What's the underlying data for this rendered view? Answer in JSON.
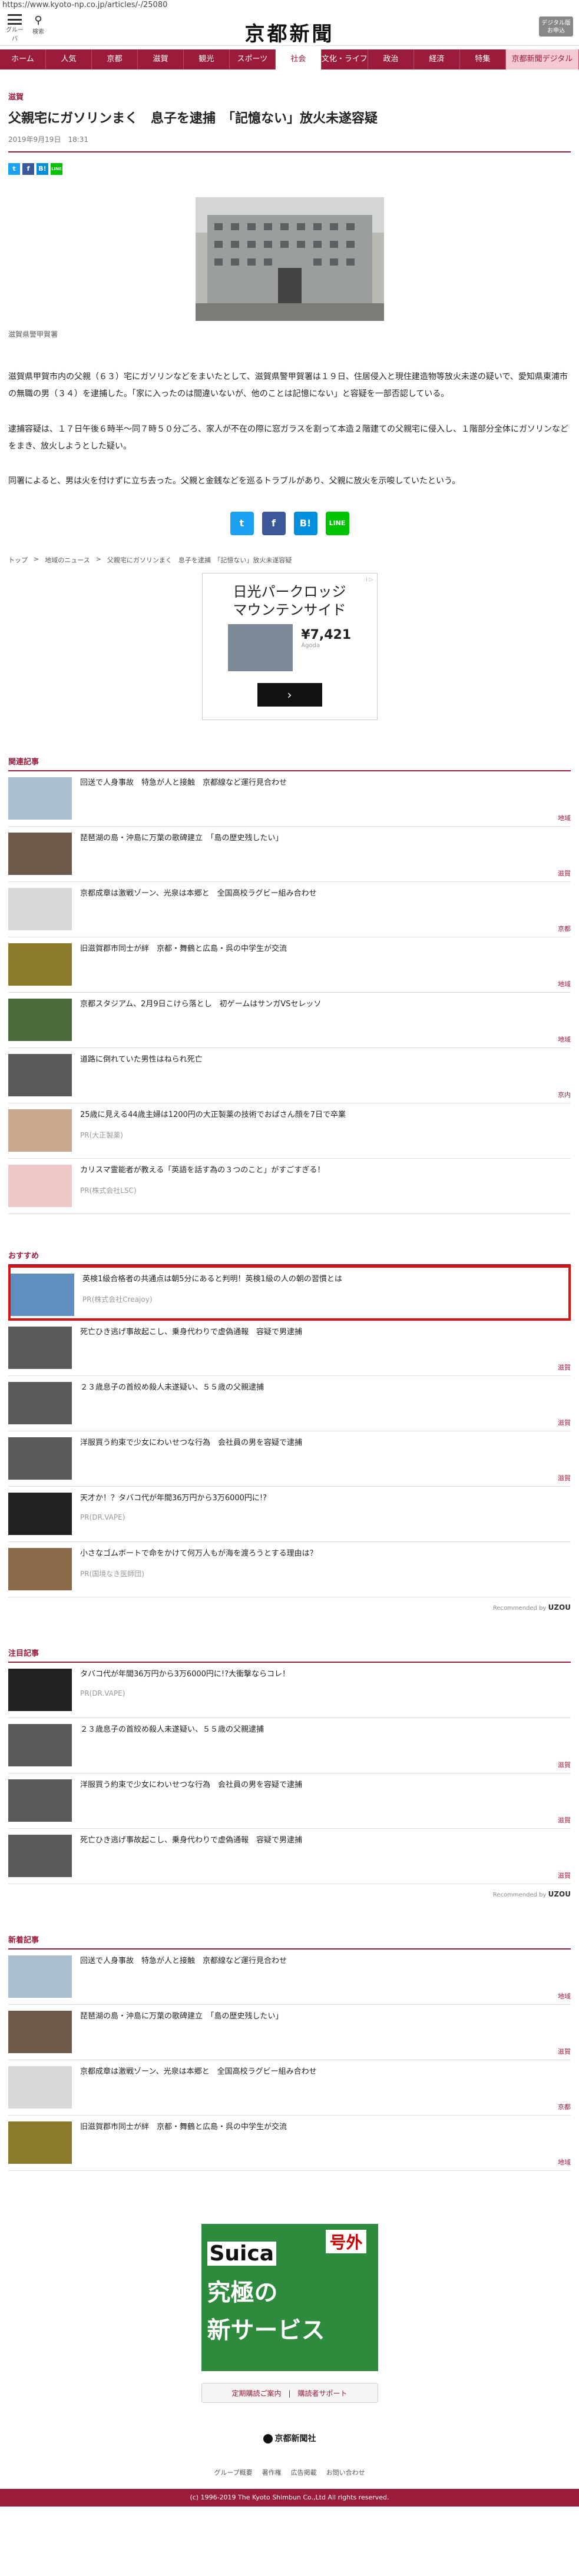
{
  "browser": {
    "url": "https://www.kyoto-np.co.jp/articles/-/25080"
  },
  "header": {
    "menu_label": "グルーバ",
    "search_label": "検索",
    "logo": "京都新聞",
    "digital_label": "デジタル版 お申込"
  },
  "nav": [
    "ホーム",
    "人気",
    "京都",
    "滋賀",
    "観光",
    "スポーツ",
    "社会",
    "文化・ライフ",
    "政治",
    "経済",
    "特集",
    "京都新聞デジタル"
  ],
  "article": {
    "section": "滋賀",
    "title": "父親宅にガソリンまく　息子を逮捕　「記憶ない」放火未遂容疑",
    "date": "2019年9月19日　18:31",
    "caption": "滋賀県警甲賀署",
    "paragraphs": [
      "滋賀県甲賀市内の父親（６３）宅にガソリンなどをまいたとして、滋賀県警甲賀署は１９日、住居侵入と現住建造物等放火未遂の疑いで、愛知県東浦市の無職の男（３４）を逮捕した。「家に入ったのは間違いないが、他のことは記憶にない」と容疑を一部否認している。",
      "逮捕容疑は、１７日午後６時半～同７時５０分ごろ、家人が不在の際に窓ガラスを割って本造２階建ての父親宅に侵入し、１階部分全体にガソリンなどをまき、放火しようとした疑い。",
      "同署によると、男は火を付けずに立ち去った。父親と金銭などを巡るトラブルがあり、父親に放火を示唆していたという。"
    ],
    "share": [
      "t",
      "f",
      "B!",
      "LINE"
    ]
  },
  "breadcrumb": [
    "トップ",
    ">",
    "地域のニュース",
    ">",
    "父親宅にガソリンまく　息子を逮捕　「記憶ない」放火未遂容疑"
  ],
  "ad": {
    "title_line1": "日光パークロッジ",
    "title_line2": "マウンテンサイド",
    "price": "¥7,421",
    "source": "Agoda",
    "arrow": "›",
    "tag": "i ▷"
  },
  "related": {
    "title": "関連記事",
    "items": [
      {
        "text": "回送で人身事故　特急が人と接触　京都線など運行見合わせ",
        "cat": "地域"
      },
      {
        "text": "琵琶湖の島・沖島に万葉の歌碑建立　「島の歴史残したい」",
        "cat": "滋賀"
      },
      {
        "text": "京都成章は激戦ゾーン、光泉は本郷と　全国高校ラグビー組み合わせ",
        "cat": "京都"
      },
      {
        "text": "旧滋賀郡市同士が絆　京都・舞鶴と広島・呉の中学生が交流",
        "cat": "地域"
      },
      {
        "text": "京都スタジアム、2月9日こけら落とし　初ゲームはサンガVSセレッソ",
        "cat": "地域"
      },
      {
        "text": "道路に倒れていた男性はねられ死亡",
        "cat": "京内"
      },
      {
        "text": "25歳に見える44歳主婦は1200円の大正製薬の技術でおばさん顔を7日で卒業",
        "sponsor": "PR(大正製薬)"
      },
      {
        "text": "カリスマ霊能者が教える「英語を話す為の３つのこと」がすごすぎる！",
        "sponsor": "PR(株式会社LSC)"
      }
    ]
  },
  "recommend": {
    "title": "おすすめ",
    "items": [
      {
        "text": "英検1級合格者の共通点は朝5分にあると判明！英検1級の人の朝の習慣とは",
        "sponsor": "PR(株式会社Creajoy)",
        "highlight": true
      },
      {
        "text": "死亡ひき逃げ事故起こし、乗身代わりで虚偽通報　容疑で男逮捕",
        "cat": "滋賀"
      },
      {
        "text": "２３歳息子の首絞め殺人未遂疑い、５５歳の父親逮捕",
        "cat": "滋賀"
      },
      {
        "text": "洋服買う約束で少女にわいせつな行為　会社員の男を容疑で逮捕",
        "cat": "滋賀"
      },
      {
        "text": "天才か！？タバコ代が年間36万円から3万6000円に!?",
        "sponsor": "PR(DR.VAPE)"
      },
      {
        "text": "小さなゴムボートで命をかけて何万人もが海を渡ろうとする理由は？",
        "sponsor": "PR(国境なき医師団)"
      }
    ],
    "credit_prefix": "Recommended by",
    "credit_brand": "UZOU"
  },
  "attention": {
    "title": "注目記事",
    "items": [
      {
        "text": "タバコ代が年間36万円から3万6000円に!?大衝撃ならコレ！",
        "sponsor": "PR(DR.VAPE)"
      },
      {
        "text": "２３歳息子の首絞め殺人未遂疑い、５５歳の父親逮捕",
        "cat": "滋賀"
      },
      {
        "text": "洋服買う約束で少女にわいせつな行為　会社員の男を容疑で逮捕",
        "cat": "滋賀"
      },
      {
        "text": "死亡ひき逃げ事故起こし、乗身代わりで虚偽通報　容疑で男逮捕",
        "cat": "滋賀"
      }
    ],
    "credit_prefix": "Recommended by",
    "credit_brand": "UZOU"
  },
  "latest": {
    "title": "新着記事",
    "items": [
      {
        "text": "回送で人身事故　特急が人と接触　京都線など運行見合わせ",
        "cat": "地域"
      },
      {
        "text": "琵琶湖の島・沖島に万葉の歌碑建立　「島の歴史残したい」",
        "cat": "滋賀"
      },
      {
        "text": "京都成章は激戦ゾーン、光泉は本郷と　全国高校ラグビー組み合わせ",
        "cat": "京都"
      },
      {
        "text": "旧滋賀郡市同士が絆　京都・舞鶴と広島・呉の中学生が交流",
        "cat": "地域"
      }
    ]
  },
  "promo": {
    "line1": "Suica",
    "line2": "究極の",
    "line3": "新サービス",
    "stamp": "号外"
  },
  "subscribe": "定期購読ご案内　|　購読者サポート",
  "footer": {
    "logo": "京都新聞社",
    "links": [
      "グループ概要",
      "著作権",
      "広告掲載",
      "お問い合わせ"
    ],
    "copyright": "(c) 1996-2019 The Kyoto Shimbun Co.,Ltd All rights reserved."
  },
  "colors": {
    "brand": "#9b1b3b",
    "highlight": "#dd1111"
  }
}
